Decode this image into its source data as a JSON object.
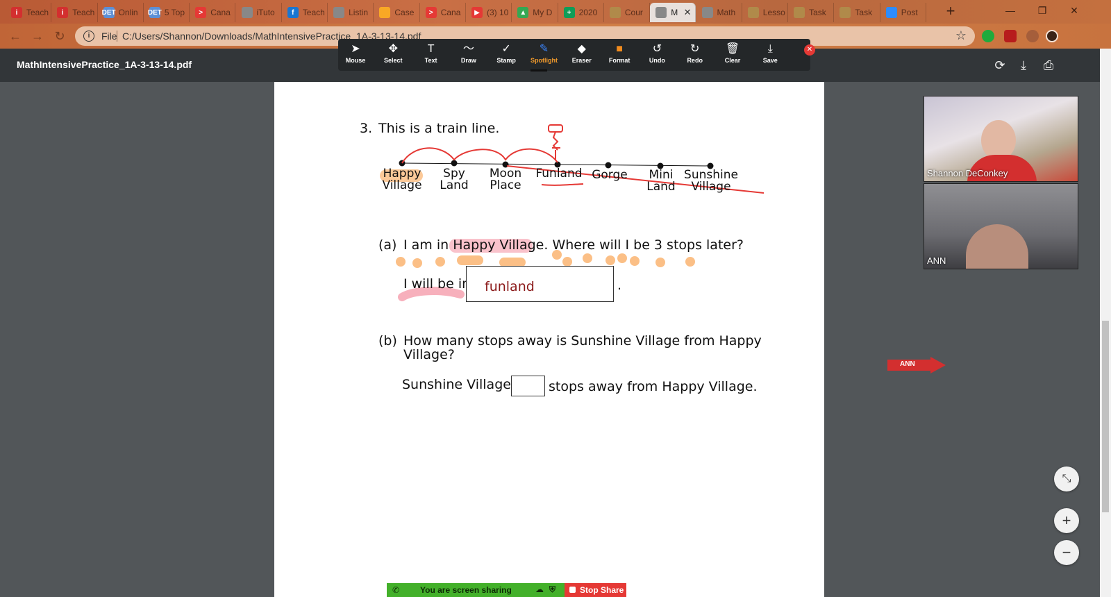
{
  "tabs": [
    {
      "label": "Teach",
      "fav": "i",
      "color": "#d32f2f"
    },
    {
      "label": "Teach",
      "fav": "i",
      "color": "#d32f2f"
    },
    {
      "label": "Onlin",
      "fav": "DET",
      "color": "#5c8fd6"
    },
    {
      "label": "5 Top",
      "fav": "DET",
      "color": "#5c8fd6"
    },
    {
      "label": "Cana",
      "fav": ">",
      "color": "#e53935"
    },
    {
      "label": "iTuto",
      "fav": "",
      "color": "#888888"
    },
    {
      "label": "Teach",
      "fav": "f",
      "color": "#1976d2"
    },
    {
      "label": "Listin",
      "fav": "",
      "color": "#888888"
    },
    {
      "label": "Case",
      "fav": "",
      "color": "#f9a825"
    },
    {
      "label": "Cana",
      "fav": ">",
      "color": "#e53935"
    },
    {
      "label": "(3) 10",
      "fav": "▶",
      "color": "#e53935"
    },
    {
      "label": "My D",
      "fav": "▲",
      "color": "#34a853"
    },
    {
      "label": "2020",
      "fav": "+",
      "color": "#0f9d58"
    },
    {
      "label": "Cour",
      "fav": "",
      "color": "#b08a4a"
    },
    {
      "label": "M",
      "fav": "",
      "color": "#888888"
    },
    {
      "label": "Math",
      "fav": "",
      "color": "#888888"
    },
    {
      "label": "Lesso",
      "fav": "",
      "color": "#b08a4a"
    },
    {
      "label": "Task",
      "fav": "",
      "color": "#b08a4a"
    },
    {
      "label": "Task",
      "fav": "",
      "color": "#b08a4a"
    },
    {
      "label": "Post",
      "fav": "",
      "color": "#2d8cff"
    }
  ],
  "address": {
    "file_label": "File",
    "url": "C:/Users/Shannon/Downloads/MathIntensivePractice_1A-3-13-14.pdf"
  },
  "pdf": {
    "title": "MathIntensivePractice_1A-3-13-14.pdf"
  },
  "annotation_tools": [
    {
      "label": "Mouse",
      "icon": "➤",
      "selected": false
    },
    {
      "label": "Select",
      "icon": "✥",
      "selected": false
    },
    {
      "label": "Text",
      "icon": "T",
      "selected": false
    },
    {
      "label": "Draw",
      "icon": "〜",
      "selected": false
    },
    {
      "label": "Stamp",
      "icon": "✓",
      "selected": false
    },
    {
      "label": "Spotlight",
      "icon": "✎",
      "selected": true
    },
    {
      "label": "Eraser",
      "icon": "◆",
      "selected": false
    },
    {
      "label": "Format",
      "icon": "■",
      "selected": false
    },
    {
      "label": "Undo",
      "icon": "↺",
      "selected": false
    },
    {
      "label": "Redo",
      "icon": "↻",
      "selected": false
    },
    {
      "label": "Clear",
      "icon": "🗑",
      "selected": false
    },
    {
      "label": "Save",
      "icon": "⤓",
      "selected": false
    }
  ],
  "worksheet": {
    "q_number": "3.",
    "q_title": "This is a train line.",
    "stations": [
      {
        "line1": "Happy",
        "line2": "Village"
      },
      {
        "line1": "Spy",
        "line2": "Land"
      },
      {
        "line1": "Moon",
        "line2": "Place"
      },
      {
        "line1": "Funland",
        "line2": ""
      },
      {
        "line1": "Gorge",
        "line2": ""
      },
      {
        "line1": "Mini",
        "line2": "Land"
      },
      {
        "line1": "Sunshine",
        "line2": "Village"
      }
    ],
    "a_label": "(a)",
    "a_question_pre": "I am in ",
    "a_question_highlight": "Happy Village",
    "a_question_post": ". Where will I be 3 stops later?",
    "a_answer_prefix": "I will be in",
    "a_answer_value": "funland",
    "a_answer_suffix": ".",
    "b_label": "(b)",
    "b_question_line1": "How many stops away is Sunshine Village from Happy",
    "b_question_line2": "Village?",
    "b_answer_prefix": "Sunshine Village is",
    "b_answer_suffix": "stops away from Happy Village."
  },
  "participants": [
    {
      "name": "Shannon DeConkey"
    },
    {
      "name": "ANN"
    }
  ],
  "pointer_label": "ANN",
  "share": {
    "status": "You are screen sharing",
    "stop_label": "Stop Share"
  },
  "colors": {
    "highlight_orange": "#fbbf86",
    "ink_red": "#e53935",
    "highlight_pink": "#f48fa0"
  }
}
